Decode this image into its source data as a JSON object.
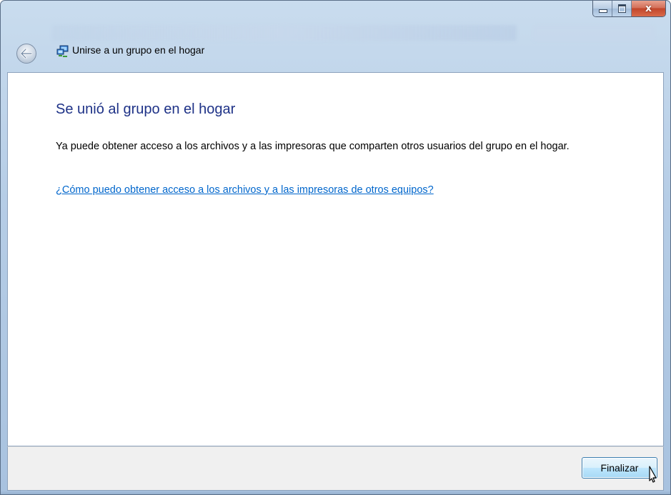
{
  "window": {
    "title": "Unirse a un grupo en el hogar",
    "caption_close_symbol": "x"
  },
  "content": {
    "heading": "Se unió al grupo en el hogar",
    "body": "Ya puede obtener acceso a los archivos y a las impresoras que comparten otros usuarios del grupo en el hogar.",
    "help_link": "¿Cómo puedo obtener acceso a los archivos y a las impresoras de otros equipos?"
  },
  "footer": {
    "finish_label": "Finalizar"
  },
  "colors": {
    "heading": "#1e3287",
    "link": "#0066cc",
    "footer_bg": "#f0f0f0",
    "close_button": "#c2462b"
  },
  "icons": [
    "back-arrow-icon",
    "homegroup-icon",
    "minimize-icon",
    "maximize-icon",
    "close-icon",
    "mouse-cursor-icon"
  ]
}
